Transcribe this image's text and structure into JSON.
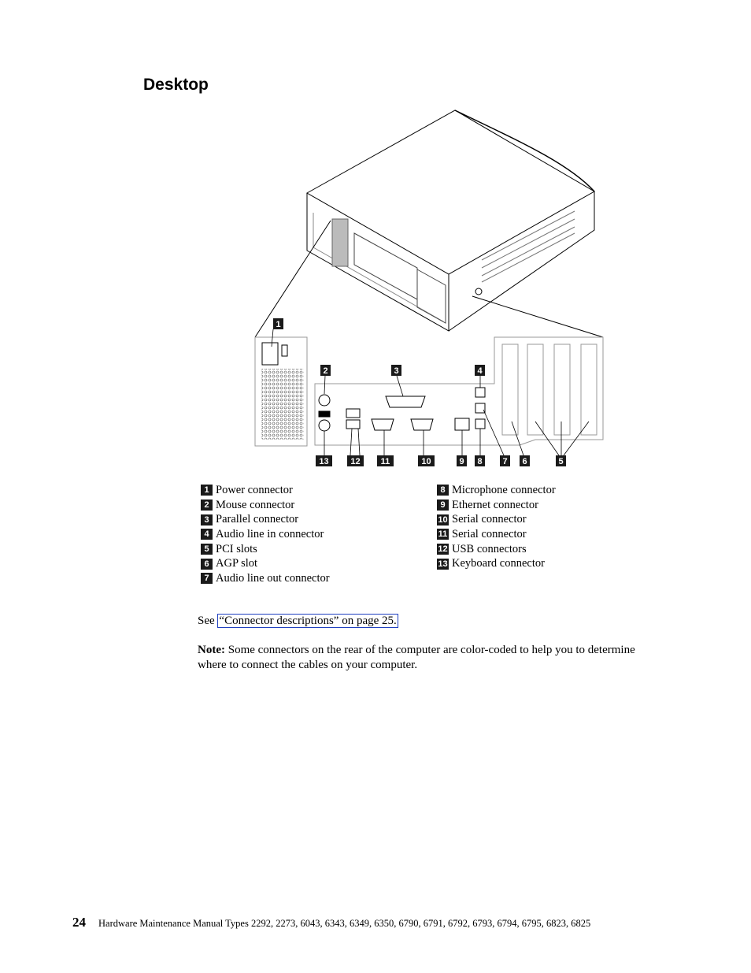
{
  "heading": "Desktop",
  "diagram_callouts": [
    "1",
    "2",
    "3",
    "4",
    "5",
    "6",
    "7",
    "8",
    "9",
    "10",
    "11",
    "12",
    "13"
  ],
  "legend_left": [
    {
      "num": "1",
      "label": "Power connector"
    },
    {
      "num": "2",
      "label": "Mouse connector"
    },
    {
      "num": "3",
      "label": "Parallel connector"
    },
    {
      "num": "4",
      "label": "Audio line in connector"
    },
    {
      "num": "5",
      "label": "PCI slots"
    },
    {
      "num": "6",
      "label": "AGP slot"
    },
    {
      "num": "7",
      "label": "Audio line out connector"
    }
  ],
  "legend_right": [
    {
      "num": "8",
      "label": "Microphone connector"
    },
    {
      "num": "9",
      "label": "Ethernet connector"
    },
    {
      "num": "10",
      "label": "Serial connector"
    },
    {
      "num": "11",
      "label": "Serial connector"
    },
    {
      "num": "12",
      "label": "USB connectors"
    },
    {
      "num": "13",
      "label": "Keyboard connector"
    }
  ],
  "see": {
    "prefix": "See ",
    "link": "“Connector descriptions” on page 25."
  },
  "note": {
    "label": "Note:",
    "text": " Some connectors on the rear of the computer are color-coded to help you to determine where to connect the cables on your computer."
  },
  "footer": {
    "page": "24",
    "title": "Hardware Maintenance Manual Types 2292, 2273, 6043, 6343, 6349, 6350, 6790, 6791, 6792, 6793, 6794, 6795, 6823, 6825"
  }
}
